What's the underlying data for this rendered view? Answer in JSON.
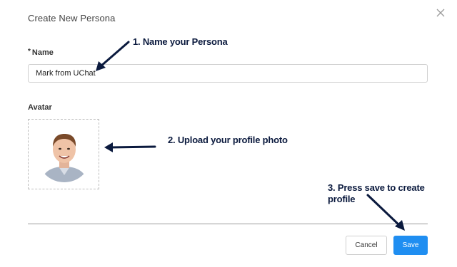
{
  "dialog": {
    "title": "Create New Persona",
    "close_icon": "close-icon"
  },
  "form": {
    "name_required_marker": "*",
    "name_label": "Name",
    "name_value": "Mark from UChat",
    "avatar_label": "Avatar",
    "avatar_icon": "user-photo"
  },
  "footer": {
    "cancel_label": "Cancel",
    "save_label": "Save"
  },
  "annotations": {
    "step1": "1. Name your Persona",
    "step2": "2. Upload your profile photo",
    "step3": "3. Press save to create profile"
  },
  "colors": {
    "primary": "#1f8ef1",
    "annotation": "#0b1a3e"
  }
}
